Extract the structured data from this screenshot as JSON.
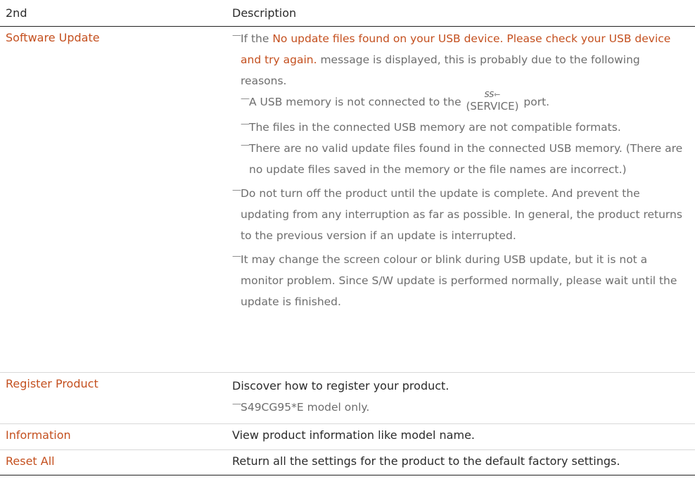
{
  "header": {
    "col1": "2nd",
    "col2": "Description"
  },
  "rows": {
    "software_update": {
      "label": "Software Update",
      "note1_pre": "If the ",
      "note1_hl": "No update files found on your USB device. Please check your USB device and try again.",
      "note1_post": " message is displayed, this is probably due to the following reasons.",
      "sub1_pre": "A USB memory is not connected to the ",
      "sub1_icon": "SS⇽",
      "sub1_port": "(SERVICE)",
      "sub1_post": " port.",
      "sub2": "The files in the connected USB memory are not compatible formats.",
      "sub3": "There are no valid update files found in the connected USB memory. (There are no update files saved in the memory or the file names are incorrect.)",
      "note2": "Do not turn off the product until the update is complete. And prevent the updating from any interruption as far as possible. In general, the product returns to the previous version if an update is interrupted.",
      "note3": "It may change the screen colour or blink during USB update, but it is not a monitor problem. Since S/W update is performed normally, please wait until the update is finished."
    },
    "register_product": {
      "label": "Register Product",
      "desc": "Discover how to register your product.",
      "note": "S49CG95*E model only."
    },
    "information": {
      "label": "Information",
      "desc": "View product information like model name."
    },
    "reset_all": {
      "label": "Reset All",
      "desc": "Return all the settings for the product to the default factory settings."
    }
  },
  "dash": "—"
}
